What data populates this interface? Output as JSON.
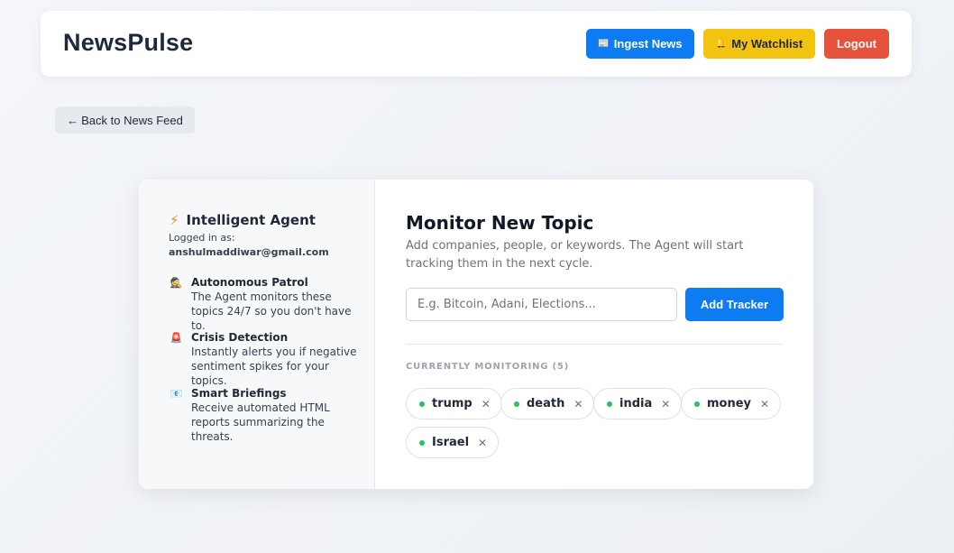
{
  "header": {
    "brand": "NewsPulse",
    "ingest_label": "Ingest News",
    "watchlist_label": "My Watchlist",
    "logout_label": "Logout",
    "ingest_icon": "📰",
    "watchlist_icon": "🔔"
  },
  "back": {
    "label": "Back to News Feed",
    "arrow": "←"
  },
  "sidebar": {
    "title": "Intelligent Agent",
    "logged_label": "Logged in as:",
    "email": "anshulmaddiwar@gmail.com",
    "features": [
      {
        "icon": "🕵",
        "title": "Autonomous Patrol",
        "desc": "The Agent monitors these topics 24/7 so you don't have to."
      },
      {
        "icon": "🚨",
        "title": "Crisis Detection",
        "desc": "Instantly alerts you if negative sentiment spikes for your topics."
      },
      {
        "icon": "📧",
        "title": "Smart Briefings",
        "desc": "Receive automated HTML reports summarizing the threats."
      }
    ]
  },
  "main": {
    "title": "Monitor New Topic",
    "description": "Add companies, people, or keywords. The Agent will start tracking them in the next cycle.",
    "input_placeholder": "E.g. Bitcoin, Adani, Elections...",
    "input_value": "",
    "add_label": "Add Tracker",
    "monitoring_label": "CURRENTLY MONITORING (5)",
    "tags": [
      "trump",
      "death",
      "india",
      "money",
      "Israel"
    ]
  },
  "colors": {
    "primary": "#0d7cf2",
    "watchlist": "#f2c40f",
    "logout": "#e5533d",
    "status_dot": "#22c55e"
  }
}
